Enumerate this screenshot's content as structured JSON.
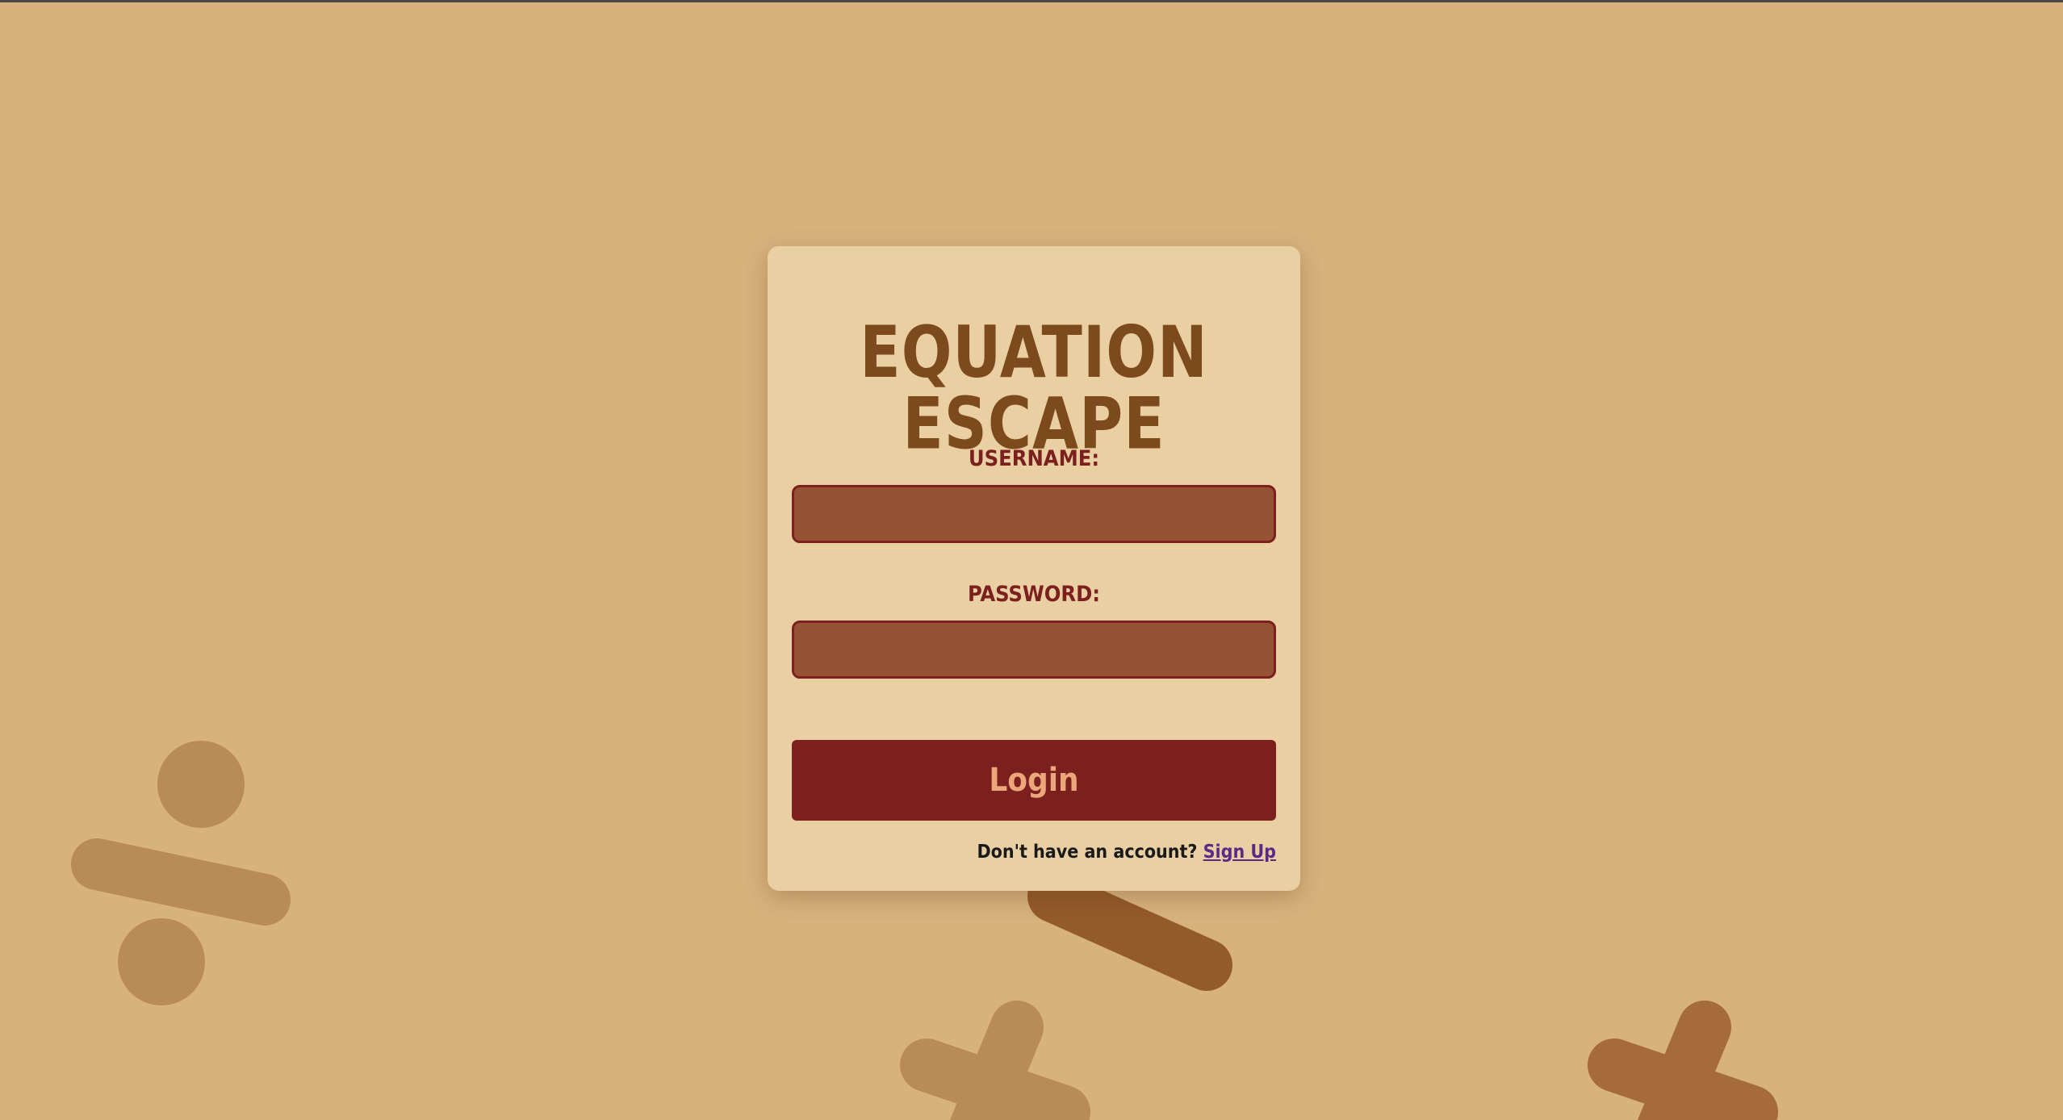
{
  "app": {
    "title": "EQUATION ESCAPE"
  },
  "login_form": {
    "username_label": "USERNAME:",
    "username_value": "",
    "password_label": "PASSWORD:",
    "password_value": "",
    "login_button_label": "Login",
    "signup_prompt": "Don't have an account?",
    "signup_link_label": "Sign Up"
  },
  "colors": {
    "background": "#d7b27d",
    "card": "#e9cfa2",
    "title": "#7c4a1d",
    "label": "#7c1f1f",
    "input_fill": "#955333",
    "button": "#7c1f1f",
    "button_text": "#eba679",
    "link": "#5b2a86"
  },
  "decorations": [
    {
      "symbol": "division-sign"
    },
    {
      "symbol": "minus-sign"
    },
    {
      "symbol": "plus-sign"
    },
    {
      "symbol": "plus-sign"
    }
  ]
}
